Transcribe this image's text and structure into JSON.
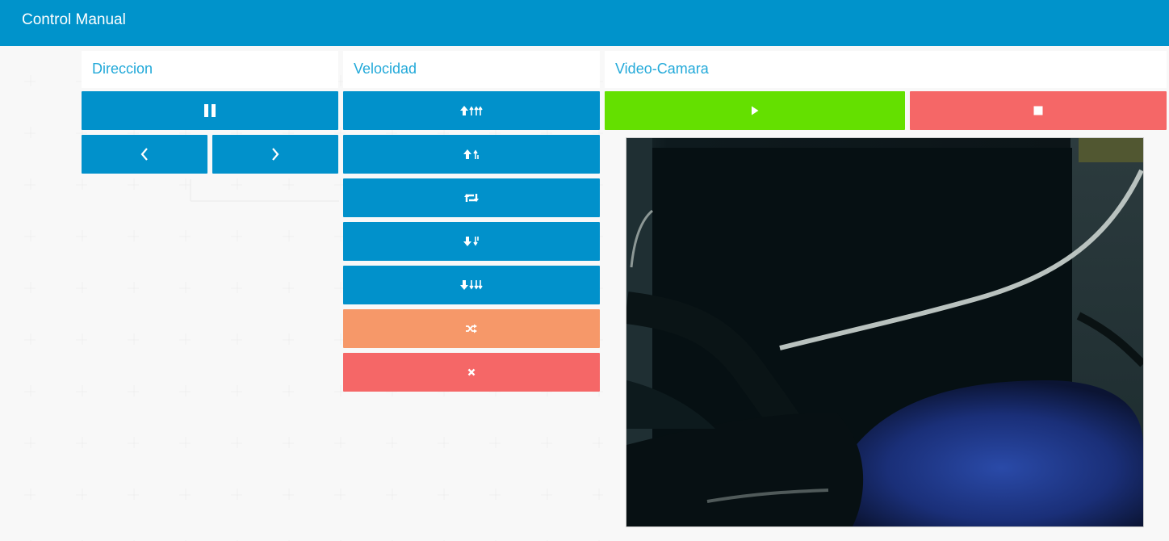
{
  "navbar": {
    "title": "Control Manual"
  },
  "panels": {
    "direccion": {
      "title": "Direccion"
    },
    "velocidad": {
      "title": "Velocidad"
    },
    "video": {
      "title": "Video-Camara"
    }
  },
  "icons": {
    "pause": "pause-icon",
    "left": "chevron-left-icon",
    "right": "chevron-right-icon",
    "speed_up_fast": "arrow-up-double-sort-icon",
    "speed_up": "arrow-up-sort-icon",
    "retweet": "retweet-icon",
    "speed_down": "arrow-down-sort-icon",
    "speed_down_fast": "arrow-down-double-sort-icon",
    "random": "random-icon",
    "stop": "times-icon",
    "play": "play-icon",
    "video_stop": "stop-icon"
  },
  "colors": {
    "navbar": "#0093cb",
    "primary": "#0191cb",
    "success": "#64e000",
    "danger": "#f56767",
    "warning": "#f69869",
    "panel_title": "#22a9d9"
  }
}
